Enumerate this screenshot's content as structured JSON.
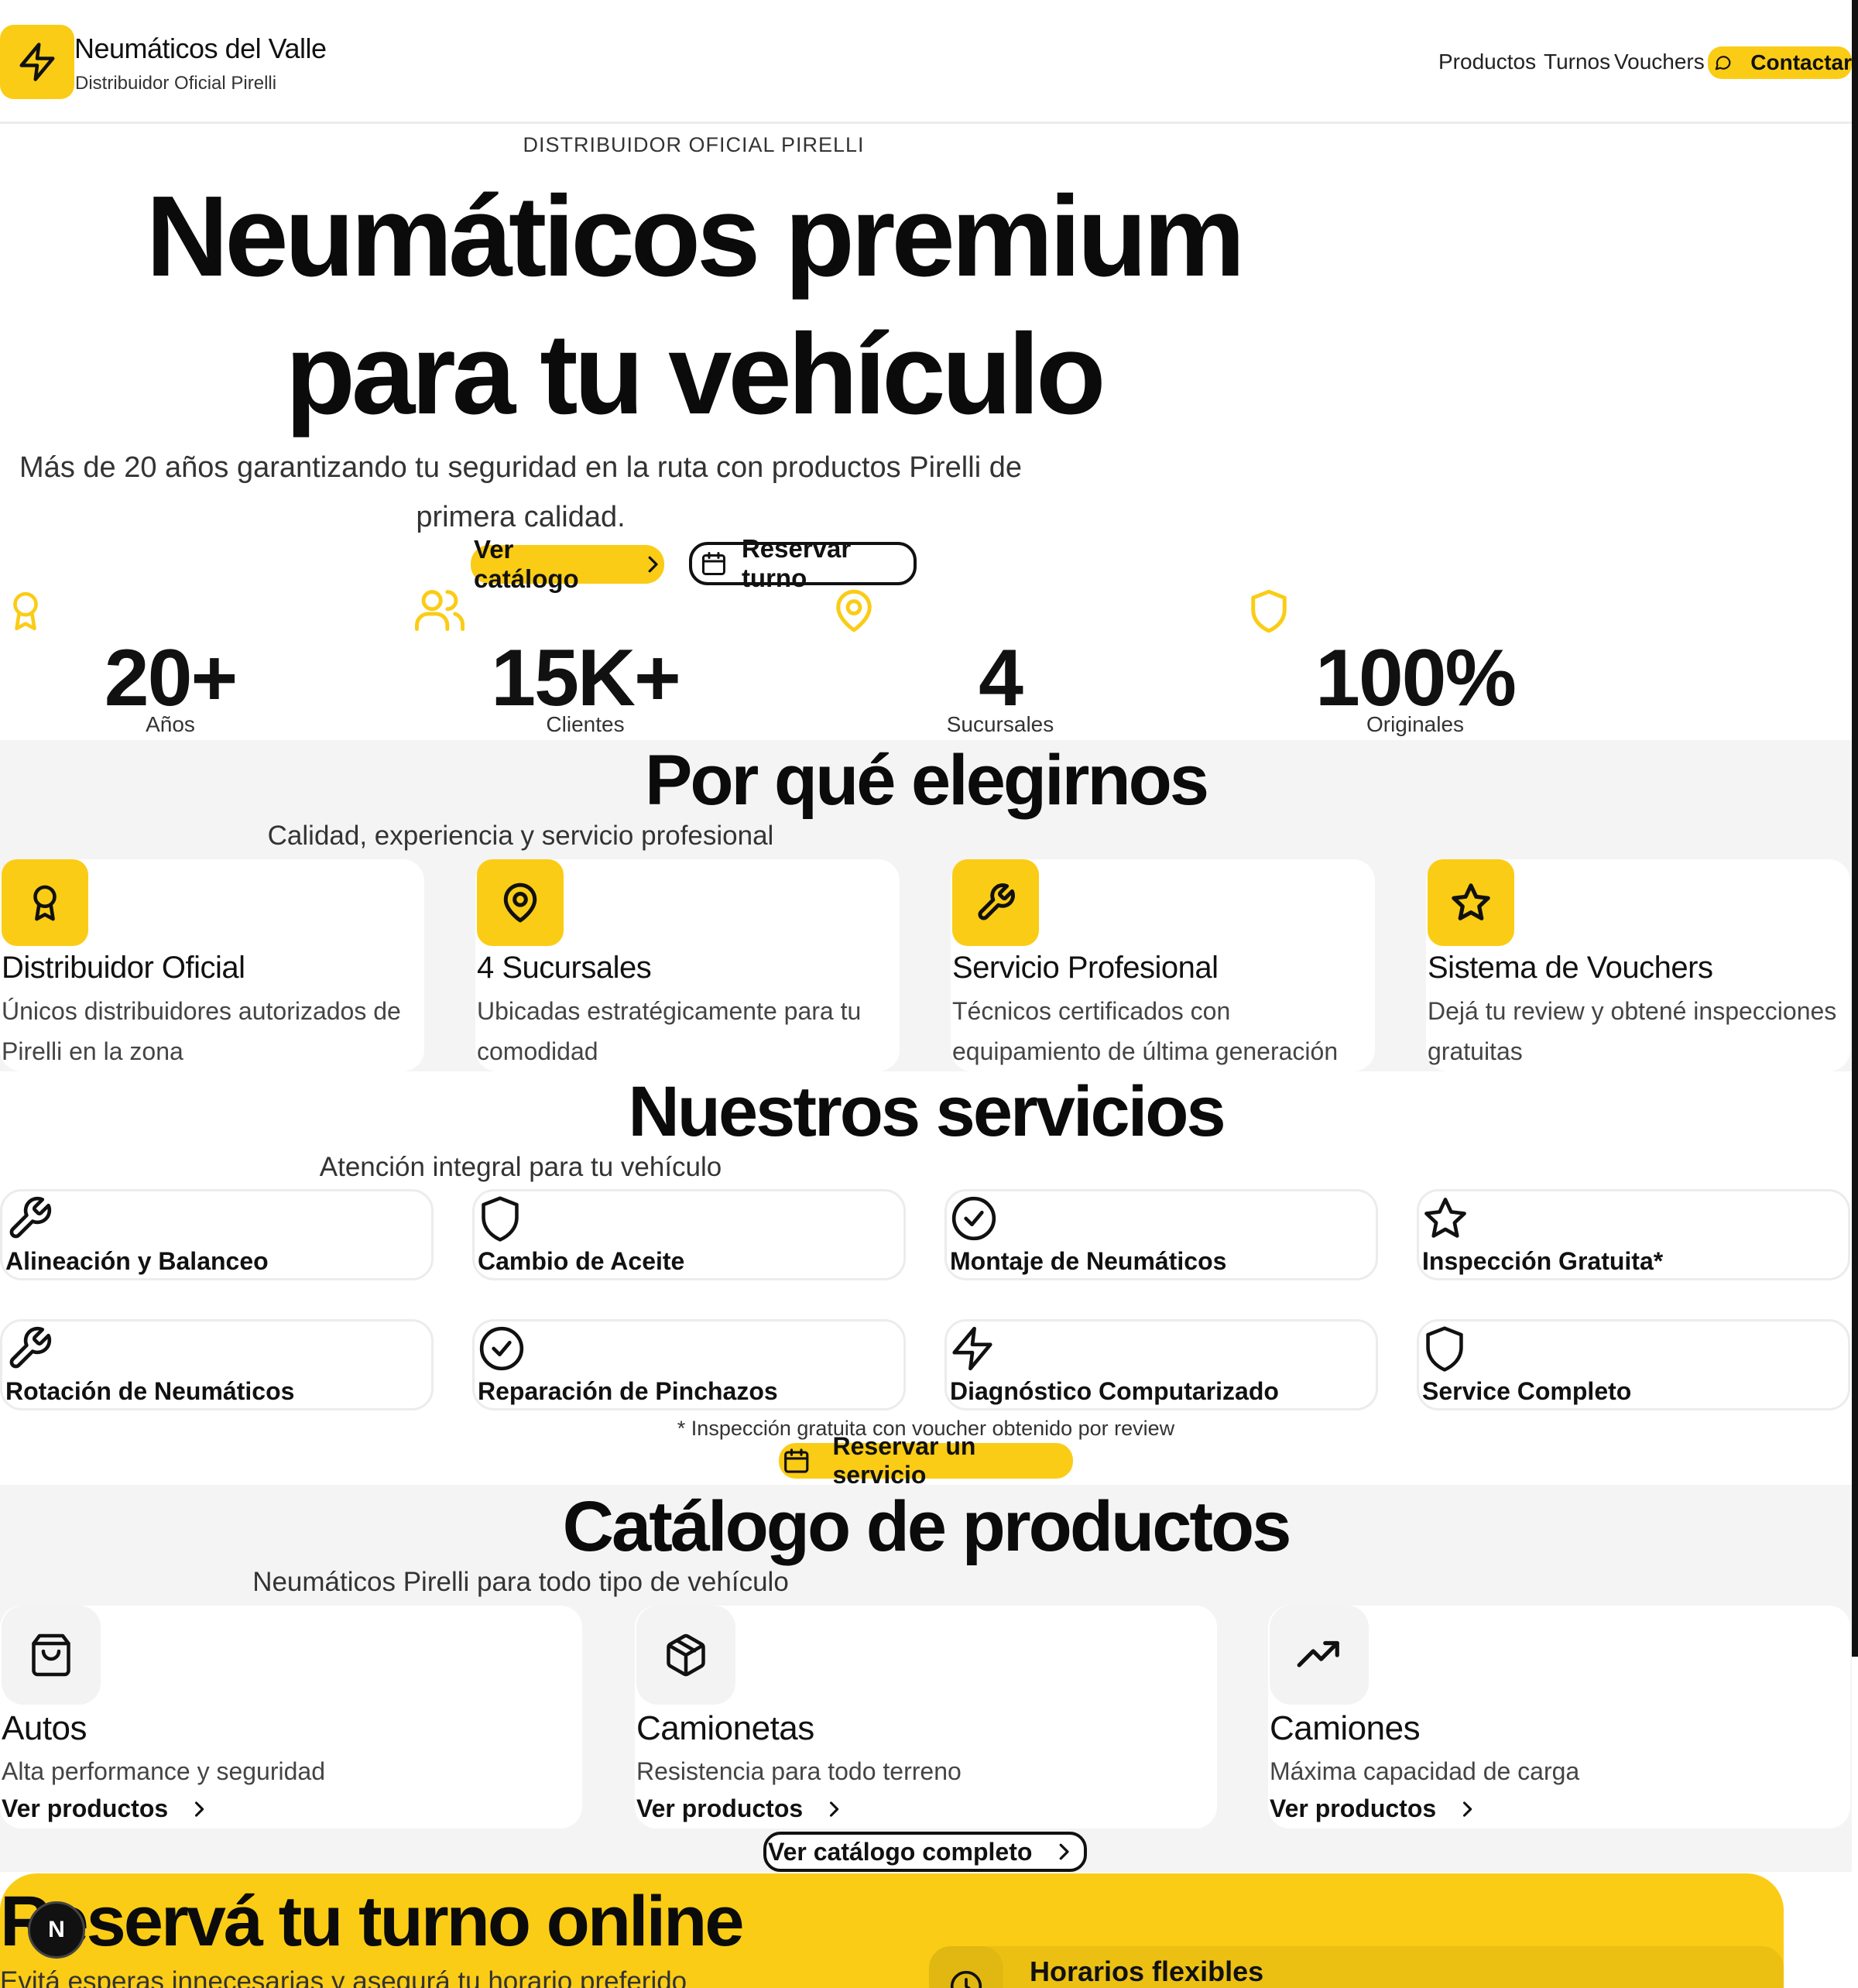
{
  "header": {
    "brand_name": "Neumáticos del Valle",
    "brand_tagline": "Distribuidor Oficial Pirelli",
    "nav": [
      "Productos",
      "Turnos",
      "Vouchers"
    ],
    "contact_label": "Contactar"
  },
  "hero": {
    "eyebrow": "DISTRIBUIDOR OFICIAL PIRELLI",
    "title_line1": "Neumáticos premium",
    "title_line2": "para tu vehículo",
    "subtitle_line1": "Más de 20 años garantizando tu seguridad en la ruta con productos Pirelli de",
    "subtitle_line2": "primera calidad.",
    "primary_button": "Ver catálogo",
    "secondary_button": "Reservar turno"
  },
  "stats": [
    {
      "value": "20+",
      "label": "Años",
      "icon": "award-icon"
    },
    {
      "value": "15K+",
      "label": "Clientes",
      "icon": "users-icon"
    },
    {
      "value": "4",
      "label": "Sucursales",
      "icon": "map-pin-icon"
    },
    {
      "value": "100%",
      "label": "Originales",
      "icon": "shield-icon"
    }
  ],
  "why": {
    "title": "Por qué elegirnos",
    "subtitle": "Calidad, experiencia y servicio profesional",
    "cards": [
      {
        "title": "Distribuidor Oficial",
        "desc_line1": "Únicos distribuidores autorizados de",
        "desc_line2": "Pirelli en la zona",
        "icon": "award-icon"
      },
      {
        "title": "4 Sucursales",
        "desc_line1": "Ubicadas estratégicamente para tu",
        "desc_line2": "comodidad",
        "icon": "map-pin-icon"
      },
      {
        "title": "Servicio Profesional",
        "desc_line1": "Técnicos certificados con",
        "desc_line2": "equipamiento de última generación",
        "icon": "wrench-icon"
      },
      {
        "title": "Sistema de Vouchers",
        "desc_line1": "Dejá tu review y obtené inspecciones",
        "desc_line2": "gratuitas",
        "icon": "star-icon"
      }
    ]
  },
  "services": {
    "title": "Nuestros servicios",
    "subtitle": "Atención integral para tu vehículo",
    "items": [
      {
        "label": "Alineación y Balanceo",
        "icon": "wrench-icon"
      },
      {
        "label": "Cambio de Aceite",
        "icon": "shield-icon"
      },
      {
        "label": "Montaje de Neumáticos",
        "icon": "check-circle-icon"
      },
      {
        "label": "Inspección Gratuita*",
        "icon": "star-icon"
      },
      {
        "label": "Rotación de Neumáticos",
        "icon": "wrench-icon"
      },
      {
        "label": "Reparación de Pinchazos",
        "icon": "check-circle-icon"
      },
      {
        "label": "Diagnóstico Computarizado",
        "icon": "zap-icon"
      },
      {
        "label": "Service Completo",
        "icon": "shield-icon"
      }
    ],
    "footnote": "* Inspección gratuita con voucher obtenido por review",
    "button": "Reservar un servicio"
  },
  "catalog": {
    "title": "Catálogo de productos",
    "subtitle": "Neumáticos Pirelli para todo tipo de vehículo",
    "cards": [
      {
        "title": "Autos",
        "desc": "Alta performance y seguridad",
        "link": "Ver productos",
        "icon": "shopping-bag-icon"
      },
      {
        "title": "Camionetas",
        "desc": "Resistencia para todo terreno",
        "link": "Ver productos",
        "icon": "box-icon"
      },
      {
        "title": "Camiones",
        "desc": "Máxima capacidad de carga",
        "link": "Ver productos",
        "icon": "trending-up-icon"
      }
    ],
    "button": "Ver catálogo completo"
  },
  "booking": {
    "title": "Reservá tu turno online",
    "subtitle": "Evitá esperas innecesarias y asegurá tu horario preferido",
    "feature": "Horarios flexibles",
    "dev_badge": "N"
  },
  "colors": {
    "accent": "#FACC15",
    "section_bg": "#F4F4F4",
    "text": "#111111"
  }
}
